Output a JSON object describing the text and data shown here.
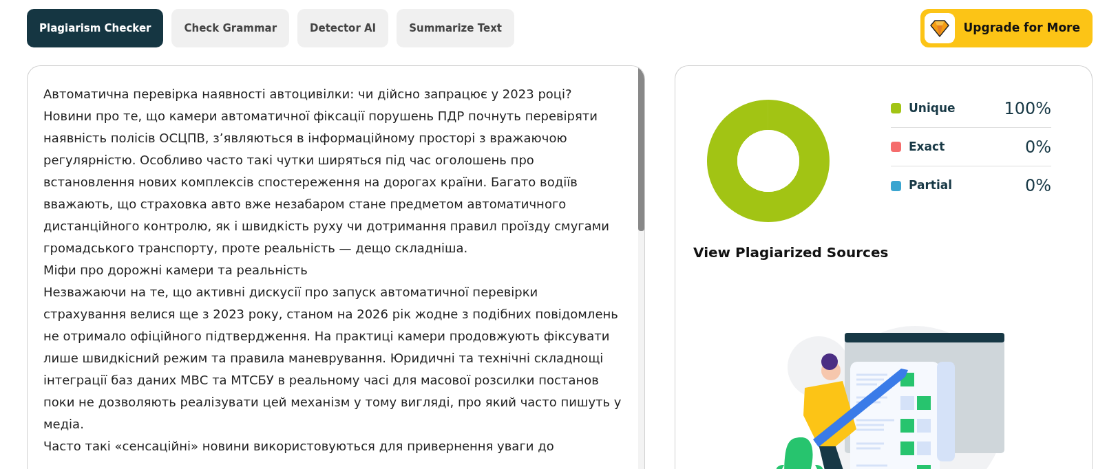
{
  "tabs": [
    {
      "label": "Plagiarism Checker",
      "selected": true
    },
    {
      "label": "Check Grammar",
      "selected": false
    },
    {
      "label": "Detector AI",
      "selected": false
    },
    {
      "label": "Summarize Text",
      "selected": false
    }
  ],
  "upgrade_button": {
    "label": "Upgrade for More"
  },
  "editor": {
    "paragraphs": [
      "Автоматична перевірка наявності автоцивілки: чи дійсно запрацює у 2023 році?",
      "Новини про те, що камери автоматичної фіксації порушень ПДР почнуть перевіряти наявність полісів ОСЦПВ, з’являються в інформаційному просторі з вражаючою регулярністю. Особливо часто такі чутки ширяться під час оголошень про встановлення нових комплексів спостереження на дорогах країни. Багато водіїв вважають, що страховка авто вже незабаром стане предметом автоматичного дистанційного контролю, як і швидкість руху чи дотримання правил проїзду смугами громадського транспорту, проте реальність — дещо складніша.",
      "Міфи про дорожні камери та реальність",
      "Незважаючи на те, що активні дискусії про запуск автоматичної перевірки страхування велися ще з 2023 року, станом на 2026 рік жодне з подібних повідомлень не отримало офіційного підтвердження. На практиці камери продовжують фіксувати лише швидкісний режим та правила маневрування. Юридичні та технічні складнощі інтеграції баз даних МВС та МТСБУ в реальному часі для масової розсилки постанов поки не дозволяють реалізувати цей механізм у тому вигляді, про який часто пишуть у медіа.",
      "Часто такі «сенсаційні» новини використовуються для привернення уваги до"
    ]
  },
  "results": {
    "legend": [
      {
        "value": "100%",
        "color": "#a2c414"
      },
      {
        "value": "0%",
        "color": "#f56c6c"
      },
      {
        "value": "0%",
        "color": "#3aa5d0"
      }
    ],
    "chart_data": {
      "type": "donut",
      "categories": [
        "Unique",
        "Exact",
        "Partial"
      ],
      "values": [
        100,
        0,
        0
      ]
    },
    "sources_heading": "View Plagiarized Sources"
  }
}
